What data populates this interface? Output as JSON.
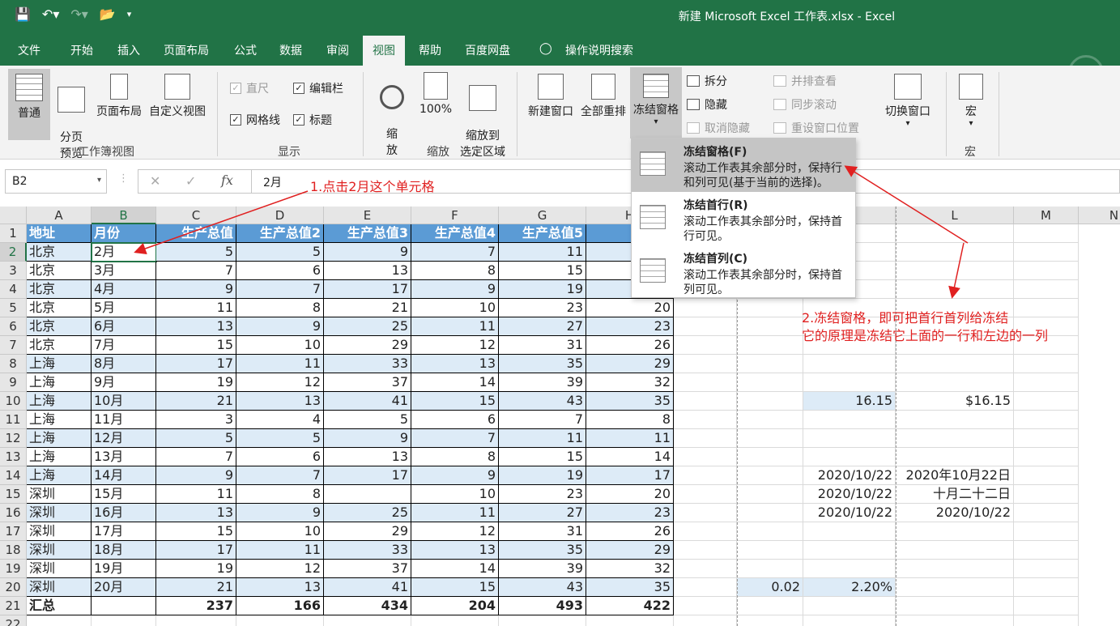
{
  "window": {
    "title": "新建 Microsoft Excel 工作表.xlsx  -  Excel"
  },
  "tabs": [
    "文件",
    "开始",
    "插入",
    "页面布局",
    "公式",
    "数据",
    "审阅",
    "视图",
    "帮助",
    "百度网盘"
  ],
  "tell_me": "操作说明搜索",
  "ribbon": {
    "workbook_views": {
      "normal": "普通",
      "page_break": "分页\n预览",
      "page_layout": "页面布局",
      "custom": "自定义视图",
      "label": "工作簿视图"
    },
    "show": {
      "ruler": "直尺",
      "formula_bar": "编辑栏",
      "gridlines": "网格线",
      "headings": "标题",
      "label": "显示"
    },
    "zoom": {
      "zoom": "缩\n放",
      "hundred": "100%",
      "to_selection": "缩放到\n选定区域",
      "label": "缩放"
    },
    "window": {
      "new_window": "新建窗口",
      "arrange_all": "全部重排",
      "freeze_panes": "冻结窗格",
      "split": "拆分",
      "hide": "隐藏",
      "unhide": "取消隐藏",
      "side_by_side": "并排查看",
      "sync_scroll": "同步滚动",
      "reset_position": "重设窗口位置",
      "switch_windows": "切换窗口"
    },
    "macros": {
      "macros": "宏",
      "label": "宏"
    }
  },
  "name_box": "B2",
  "formula_value": "2月",
  "freeze_menu": [
    {
      "title": "冻结窗格(F)",
      "desc": "滚动工作表其余部分时，保持行和列可见(基于当前的选择)。"
    },
    {
      "title": "冻结首行(R)",
      "desc": "滚动工作表其余部分时，保持首行可见。"
    },
    {
      "title": "冻结首列(C)",
      "desc": "滚动工作表其余部分时，保持首列可见。"
    }
  ],
  "columns": [
    "A",
    "B",
    "C",
    "D",
    "E",
    "F",
    "G",
    "H",
    "",
    "",
    "",
    "L",
    "M",
    "N"
  ],
  "table": {
    "headers": [
      "地址",
      "月份",
      "生产总值",
      "生产总值2",
      "生产总值3",
      "生产总值4",
      "生产总值5",
      "生产总"
    ],
    "rows": [
      [
        "北京",
        "2月",
        "5",
        "5",
        "9",
        "7",
        "11",
        ""
      ],
      [
        "北京",
        "3月",
        "7",
        "6",
        "13",
        "8",
        "15",
        ""
      ],
      [
        "北京",
        "4月",
        "9",
        "7",
        "17",
        "9",
        "19",
        ""
      ],
      [
        "北京",
        "5月",
        "11",
        "8",
        "21",
        "10",
        "23",
        "20"
      ],
      [
        "北京",
        "6月",
        "13",
        "9",
        "25",
        "11",
        "27",
        "23"
      ],
      [
        "北京",
        "7月",
        "15",
        "10",
        "29",
        "12",
        "31",
        "26"
      ],
      [
        "上海",
        "8月",
        "17",
        "11",
        "33",
        "13",
        "35",
        "29"
      ],
      [
        "上海",
        "9月",
        "19",
        "12",
        "37",
        "14",
        "39",
        "32"
      ],
      [
        "上海",
        "10月",
        "21",
        "13",
        "41",
        "15",
        "43",
        "35"
      ],
      [
        "上海",
        "11月",
        "3",
        "4",
        "5",
        "6",
        "7",
        "8"
      ],
      [
        "上海",
        "12月",
        "5",
        "5",
        "9",
        "7",
        "11",
        "11"
      ],
      [
        "上海",
        "13月",
        "7",
        "6",
        "13",
        "8",
        "15",
        "14"
      ],
      [
        "上海",
        "14月",
        "9",
        "7",
        "17",
        "9",
        "19",
        "17"
      ],
      [
        "深圳",
        "15月",
        "11",
        "8",
        "",
        "10",
        "23",
        "20"
      ],
      [
        "深圳",
        "16月",
        "13",
        "9",
        "25",
        "11",
        "27",
        "23"
      ],
      [
        "深圳",
        "17月",
        "15",
        "10",
        "29",
        "12",
        "31",
        "26"
      ],
      [
        "深圳",
        "18月",
        "17",
        "11",
        "33",
        "13",
        "35",
        "29"
      ],
      [
        "深圳",
        "19月",
        "19",
        "12",
        "37",
        "14",
        "39",
        "32"
      ],
      [
        "深圳",
        "20月",
        "21",
        "13",
        "41",
        "15",
        "43",
        "35"
      ]
    ],
    "total": [
      "汇总",
      "",
      "237",
      "166",
      "434",
      "204",
      "493",
      "422"
    ]
  },
  "side_cells": {
    "k10": "16.15",
    "l10": "$16.15",
    "k14": "2020/10/22",
    "l14": "2020年10月22日",
    "k15": "2020/10/22",
    "l15": "十月二十二日",
    "k16": "2020/10/22",
    "l16": "2020/10/22",
    "j20": "0.02",
    "k20": "2.20%"
  },
  "annotations": {
    "step1": "1.点击2月这个单元格",
    "step2_line1": "2.冻结窗格，即可把首行首列给冻结",
    "step2_line2": "它的原理是冻结它上面的一行和左边的一列"
  }
}
